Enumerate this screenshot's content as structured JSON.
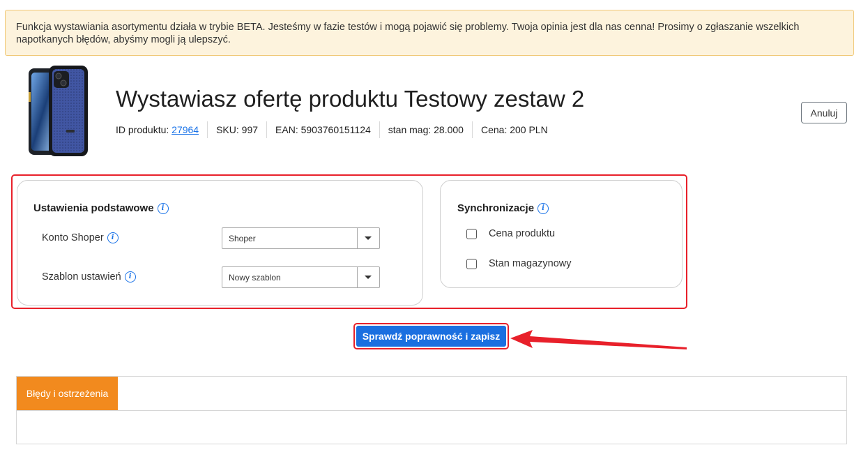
{
  "banner": {
    "text": "Funkcja wystawiania asortymentu działa w trybie BETA. Jesteśmy w fazie testów i mogą pojawić się problemy. Twoja opinia jest dla nas cenna! Prosimy o zgłaszanie wszelkich napotkanych błędów, abyśmy mogli ją ulepszyć."
  },
  "product": {
    "title": "Wystawiasz ofertę produktu Testowy zestaw 2",
    "id_label": "ID produktu: ",
    "id_value": "27964",
    "sku": "SKU: 997",
    "ean": "EAN: 5903760151124",
    "stock": "stan mag: 28.000",
    "price": "Cena: 200 PLN",
    "image_icon": "phone-case-image"
  },
  "actions": {
    "cancel_label": "Anuluj",
    "save_label": "Sprawdź poprawność i zapisz"
  },
  "basic_settings": {
    "title": "Ustawienia podstawowe",
    "account_label": "Konto Shoper",
    "account_value": "Shoper",
    "template_label": "Szablon ustawień",
    "template_value": "Nowy szablon"
  },
  "sync": {
    "title": "Synchronizacje",
    "price_label": "Cena produktu",
    "stock_label": "Stan magazynowy",
    "price_checked": false,
    "stock_checked": false
  },
  "errors": {
    "tab_label": "Błędy i ostrzeżenia"
  },
  "colors": {
    "accent_blue": "#1a6fe0",
    "highlight_red": "#e8202a",
    "tab_orange": "#f28a1e",
    "banner_bg": "#fdf3dd"
  }
}
